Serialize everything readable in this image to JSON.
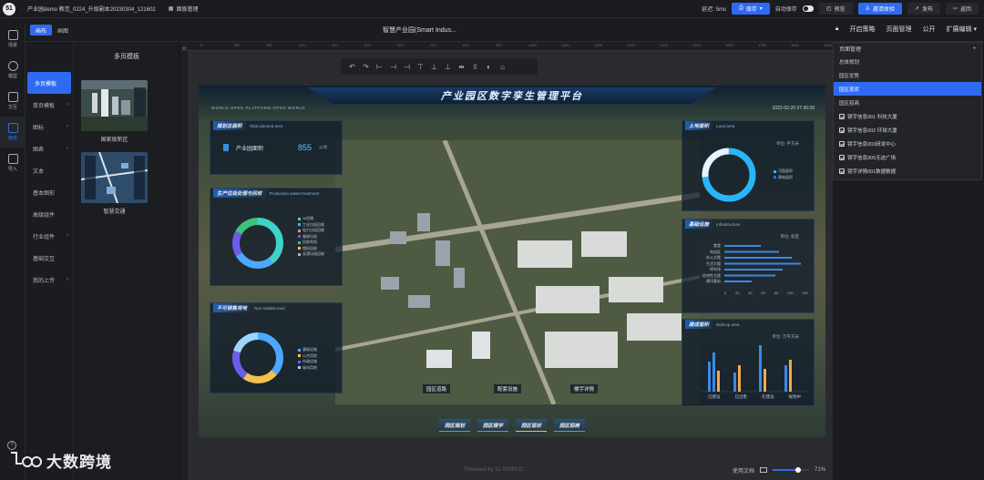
{
  "app": {
    "logo_text": "51",
    "project_title": "产业园demo 教范_0224_升级副本20230304_121602",
    "dashboard_manager": "面板管理",
    "latency": "延迟: 5ms",
    "save_label": "保存",
    "autosave_label": "自动保存",
    "preview_label": "预览",
    "invite_label": "邀请体验",
    "publish_label": "发布",
    "back_label": "返回"
  },
  "subbar": {
    "mode_tabs": [
      "画布",
      "画图"
    ],
    "active_mode": "画布",
    "center_title": "智慧产业园(Smart Indus...",
    "right_tools": [
      "开启策略",
      "页面管理",
      "公开",
      "扩展编辑"
    ]
  },
  "left_rail": [
    {
      "label": "场景",
      "icon": "scene-icon"
    },
    {
      "label": "模型",
      "icon": "cube-icon"
    },
    {
      "label": "交互",
      "icon": "interaction-icon"
    },
    {
      "label": "面板",
      "icon": "panel-icon"
    },
    {
      "label": "导入",
      "icon": "import-icon"
    }
  ],
  "left_rail_active": "面板",
  "categories": [
    {
      "label": "多页模板",
      "chevron": false
    },
    {
      "label": "单页模板",
      "chevron": true
    },
    {
      "label": "图标",
      "chevron": true
    },
    {
      "label": "图表",
      "chevron": true
    },
    {
      "label": "文本",
      "chevron": false
    },
    {
      "label": "基本图形",
      "chevron": false
    },
    {
      "label": "高级组件",
      "chevron": false
    },
    {
      "label": "行业组件",
      "chevron": true
    },
    {
      "label": "基础交互",
      "chevron": false
    },
    {
      "label": "我的上传",
      "chevron": true
    }
  ],
  "template_panel": {
    "title": "多页模板",
    "templates": [
      {
        "label": "国家级新区"
      },
      {
        "label": "智慧交通"
      }
    ]
  },
  "ruler_ticks": [
    "0",
    "100",
    "200",
    "300",
    "400",
    "500",
    "600",
    "700",
    "800",
    "900",
    "1000",
    "1100",
    "1200",
    "1300",
    "1400",
    "1500",
    "1600",
    "1700",
    "1800",
    "1900"
  ],
  "preview": {
    "title": "产业园区数字孪生管理平台",
    "brand": "WORLD  OPEN PLATFORM OPEN WORLD",
    "datetime": "2022-02-20  07:30:28",
    "panels": {
      "planned_area": {
        "title": "规划总面积",
        "sub": "Total planned area",
        "metric_label": "产业园面积",
        "metric_value": "855",
        "metric_unit": "公顷"
      },
      "production": {
        "title": "生产垃圾处理与回收",
        "sub": "Production waste treatment",
        "legend": [
          "1#回收",
          "工业垃圾回收",
          "电力垃圾回收",
          "餐厨垃圾",
          "回收利用",
          "塑料回收",
          "长漂垃圾回收"
        ]
      },
      "nonsale": {
        "title": "不可销售用地",
        "sub": "Non-salable land",
        "legend": [
          "基础设施",
          "公共用地",
          "市政设施",
          "绿化用地"
        ]
      },
      "land_area": {
        "title": "土地面积",
        "sub": "Land area",
        "unit": "单位: 平方米",
        "legend": [
          "可租面积",
          "建筑面积"
        ]
      },
      "infrastructure": {
        "title": "基础设施",
        "sub": "Infrastructure",
        "unit": "单位: 处室",
        "rows": [
          "食堂",
          "电站区",
          "办公大楼",
          "生活大楼",
          "停车场",
          "综合性大楼",
          "通讯基站"
        ],
        "ticks": [
          "0",
          "20",
          "40",
          "60",
          "80",
          "100",
          "120"
        ]
      },
      "built_up": {
        "title": "建成面积",
        "sub": "Built-up area",
        "unit": "单位: 万平方米",
        "categories": [
          "已建设",
          "已出售",
          "在建设",
          "规划中"
        ]
      }
    },
    "map_labels": [
      "园区道路",
      "配套设施",
      "楼宇详情"
    ],
    "bottom_tabs": [
      "园区规划",
      "园区楼宇",
      "园区现状",
      "园区招商"
    ]
  },
  "canvas_footer": {
    "doc_label": "使用文档",
    "zoom": "71%",
    "zoom_value": 0.71
  },
  "powered_by": "Powered by 51 WORLD",
  "page_manager": {
    "title": "页面管理",
    "items": [
      {
        "label": "总体规划",
        "checkbox": false
      },
      {
        "label": "园区优势",
        "checkbox": false
      },
      {
        "label": "园区现状",
        "checkbox": false
      },
      {
        "label": "园区招商",
        "checkbox": false
      },
      {
        "label": "镜宇信息001 科技大厦",
        "checkbox": true
      },
      {
        "label": "镜宇信息002 环球大厦",
        "checkbox": true
      },
      {
        "label": "镜宇信息003研发中心",
        "checkbox": true
      },
      {
        "label": "镜宇信息005无迹广场",
        "checkbox": true
      },
      {
        "label": "镜宇详情001数据数据",
        "checkbox": true
      }
    ],
    "active": "园区现状"
  },
  "watermark": "大数跨境",
  "colors": {
    "accent": "#2f6bf2",
    "bg": "#141518",
    "panel_bg": "#1b1c20"
  }
}
